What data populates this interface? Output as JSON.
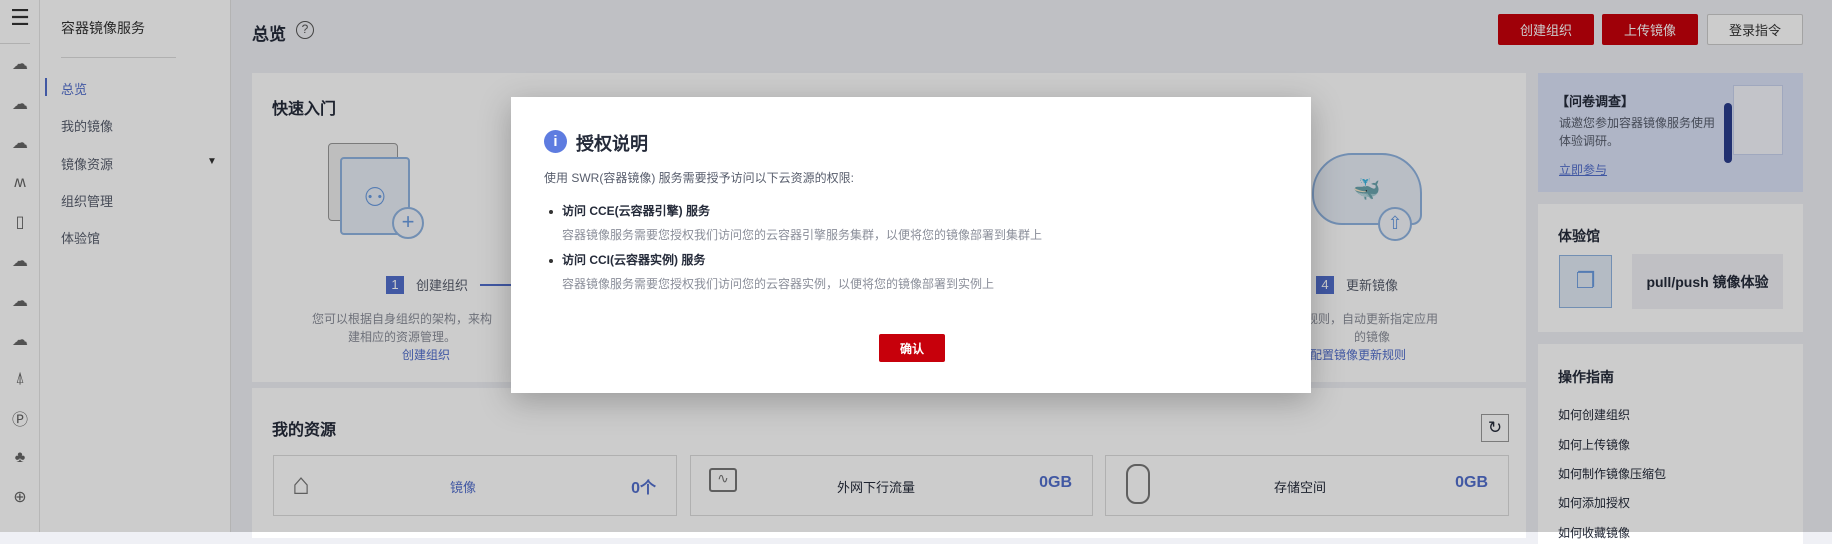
{
  "rail_icons": [
    "menu-icon",
    "cloud-server-icon",
    "cloud-chat-icon",
    "cloud-storage-icon",
    "cluster-icon",
    "phone-icon",
    "cloud-icon",
    "cloud-upload-icon",
    "cloud-check-icon",
    "tower-icon",
    "ip-icon",
    "cluster-nodes-icon",
    "globe-icon"
  ],
  "nav": {
    "title": "容器镜像服务",
    "items": [
      {
        "label": "总览"
      },
      {
        "label": "我的镜像"
      },
      {
        "label": "镜像资源"
      },
      {
        "label": "组织管理"
      },
      {
        "label": "体验馆"
      }
    ]
  },
  "header": {
    "title": "总览",
    "create_org": "创建组织",
    "upload_image": "上传镜像",
    "login_cmd": "登录指令"
  },
  "quickstart": {
    "title": "快速入门",
    "step1": {
      "num": "1",
      "label": "创建组织",
      "desc1": "您可以根据自身组织的架构，来构",
      "desc2": "建相应的资源管理。",
      "link": "创建组织"
    },
    "step4": {
      "num": "4",
      "label": "更新镜像",
      "desc1": "规则，自动更新指定应用",
      "desc2": "的镜像",
      "link": "配置镜像更新规则"
    }
  },
  "resources": {
    "title": "我的资源",
    "items": [
      {
        "label": "镜像",
        "value": "0个"
      },
      {
        "label": "外网下行流量",
        "value": "0GB"
      },
      {
        "label": "存储空间",
        "value": "0GB"
      }
    ]
  },
  "survey": {
    "title": "【问卷调查】",
    "desc1": "诚邀您参加容器镜像服务使用",
    "desc2": "体验调研。",
    "link": "立即参与"
  },
  "lab": {
    "title": "体验馆",
    "card": "pull/push 镜像体验"
  },
  "guide": {
    "title": "操作指南",
    "items": [
      "如何创建组织",
      "如何上传镜像",
      "如何制作镜像压缩包",
      "如何添加授权",
      "如何收藏镜像"
    ]
  },
  "modal": {
    "title": "授权说明",
    "intro": "使用 SWR(容器镜像) 服务需要授予访问以下云资源的权限:",
    "items": [
      {
        "title": "访问 CCE(云容器引擎) 服务",
        "desc": "容器镜像服务需要您授权我们访问您的云容器引擎服务集群，以便将您的镜像部署到集群上"
      },
      {
        "title": "访问 CCI(云容器实例) 服务",
        "desc": "容器镜像服务需要您授权我们访问您的云容器实例，以便将您的镜像部署到实例上"
      }
    ],
    "confirm": "确认"
  }
}
